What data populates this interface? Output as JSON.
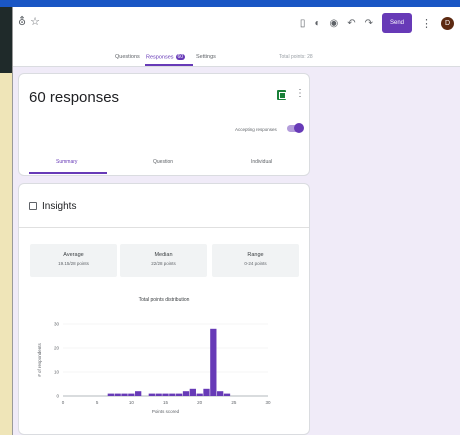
{
  "header": {
    "send_label": "Send",
    "avatar_initial": "D"
  },
  "tabs": {
    "questions": "Questions",
    "responses": "Responses",
    "responses_badge": "60",
    "settings": "Settings",
    "total_points": "Total points: 28"
  },
  "summary_card": {
    "title": "60 responses",
    "accepting_label": "Accepting responses",
    "accepting": true,
    "subtabs": [
      "Summary",
      "Question",
      "Individual"
    ],
    "active_subtab": "Summary"
  },
  "insights": {
    "title": "Insights",
    "stats": [
      {
        "label": "Average",
        "value": "19.15/28 points"
      },
      {
        "label": "Median",
        "value": "22/28 points"
      },
      {
        "label": "Range",
        "value": "0-24 points"
      }
    ]
  },
  "colors": {
    "accent": "#673ab7",
    "background": "#f0ebf8",
    "sheets_green": "#188038"
  },
  "chart_data": {
    "type": "bar",
    "title": "Total points distribution",
    "xlabel": "Points scored",
    "ylabel": "# of respondents",
    "xlim": [
      0,
      30
    ],
    "ylim": [
      0,
      30
    ],
    "x_ticks": [
      0,
      5,
      10,
      15,
      20,
      25,
      30
    ],
    "y_ticks": [
      0,
      10,
      20,
      30
    ],
    "x": [
      7,
      8,
      9,
      10,
      11,
      12,
      13,
      14,
      15,
      16,
      17,
      18,
      19,
      20,
      21,
      22,
      23,
      24
    ],
    "values": [
      1,
      1,
      1,
      1,
      2,
      0,
      1,
      1,
      1,
      1,
      1,
      2,
      3,
      1,
      3,
      28,
      2,
      1
    ]
  }
}
